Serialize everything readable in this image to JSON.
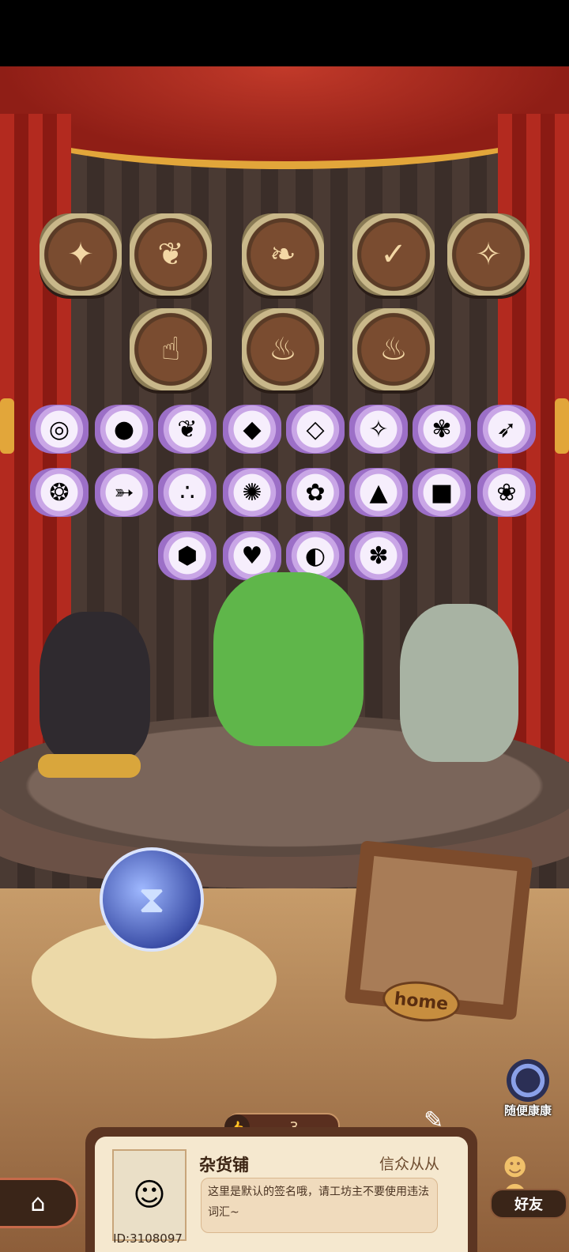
{
  "top_bar": {},
  "medals": {
    "row1": [
      "book-icon",
      "leaf-swirl-icon",
      "heart-icon",
      "scroll-check-icon",
      "fairy-icon"
    ],
    "row2": [
      "hand-plant-icon",
      "cauldron-icon",
      "cauldron-sparkle-icon"
    ]
  },
  "ingredients": {
    "row1": [
      "mirror",
      "tomato",
      "herb",
      "coal",
      "salt",
      "crystal",
      "wheat",
      "feather"
    ],
    "row2": [
      "blue-orb",
      "rainbow-feather",
      "seeds",
      "coral",
      "purple-flower",
      "lava-rock",
      "bread",
      "white-flower"
    ],
    "row3": [
      "honeycomb",
      "potion-bottle",
      "bone",
      "blue-flower"
    ]
  },
  "stage": {
    "home_sign": "home",
    "random_visit_label": "随便康康"
  },
  "profile_card": {
    "likes": "3",
    "shop_name": "杂货铺",
    "role": "信众从从",
    "signature": "这里是默认的签名哦，请工坊主不要使用违法词汇~",
    "user_id": "ID:3108097"
  },
  "nav": {
    "friends_label": "好友"
  }
}
